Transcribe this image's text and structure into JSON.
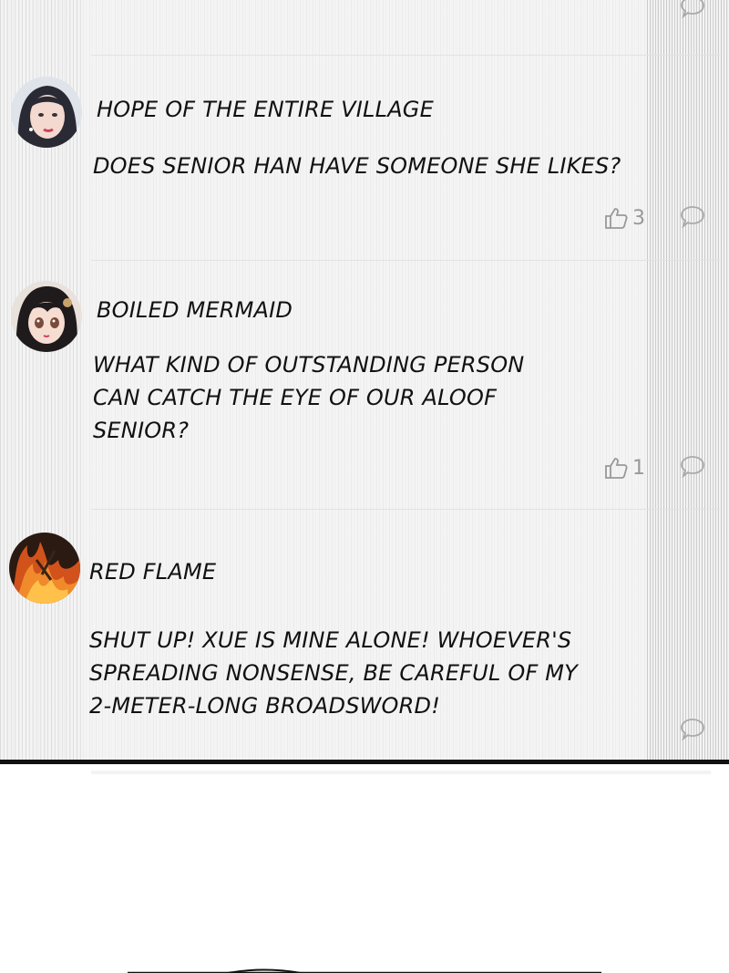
{
  "comments": [
    {
      "username": "HOPE OF THE ENTIRE VILLAGE",
      "lines": [
        "DOES SENIOR HAN HAVE SOMEONE SHE LIKES?"
      ],
      "likes": "3",
      "avatar": "woman-portrait-avatar"
    },
    {
      "username": "BOILED MERMAID",
      "lines": [
        "WHAT KIND OF OUTSTANDING PERSON",
        "CAN CATCH THE EYE OF OUR ALOOF",
        "SENIOR?"
      ],
      "likes": "1",
      "avatar": "anime-girl-avatar"
    },
    {
      "username": "RED FLAME",
      "lines": [
        "SHUT UP! XUE IS MINE ALONE! WHOEVER'S",
        "SPREADING NONSENSE, BE CAREFUL OF MY",
        "2-METER-LONG BROADSWORD!"
      ],
      "avatar": "flame-avatar"
    }
  ],
  "icons": {
    "like": "thumbs-up-icon",
    "reply": "speech-bubble-icon"
  }
}
